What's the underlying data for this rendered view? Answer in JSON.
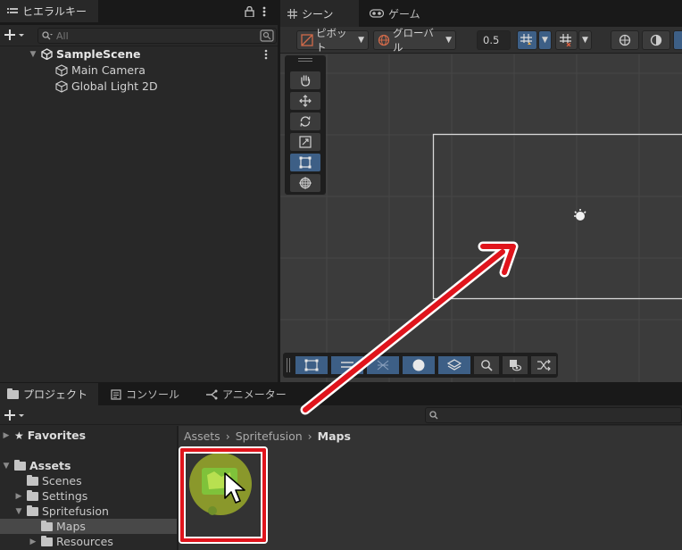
{
  "hierarchy": {
    "tab_label": "ヒエラルキー",
    "search_placeholder": "All",
    "scene_name": "SampleScene",
    "objects": [
      "Main Camera",
      "Global Light 2D"
    ]
  },
  "scene": {
    "tabs": [
      {
        "label": "シーン",
        "icon": "grid-icon"
      },
      {
        "label": "ゲーム",
        "icon": "gamepad-icon"
      }
    ],
    "toolbar": {
      "pivot_label": "ピボット",
      "global_label": "グローバル",
      "snap_value": "0.5"
    },
    "tools": [
      "hand-tool",
      "move-tool",
      "rotate-tool",
      "scale-tool",
      "rect-tool",
      "transform-tool"
    ],
    "selected_tool": "rect-tool"
  },
  "project": {
    "tabs": [
      {
        "label": "プロジェクト",
        "icon": "folder-icon"
      },
      {
        "label": "コンソール",
        "icon": "console-icon"
      },
      {
        "label": "アニメーター",
        "icon": "animator-icon"
      }
    ],
    "breadcrumb": [
      "Assets",
      "Spritefusion",
      "Maps"
    ],
    "favorites_label": "Favorites",
    "tree": [
      {
        "label": "Assets",
        "depth": 0,
        "expanded": true
      },
      {
        "label": "Scenes",
        "depth": 1
      },
      {
        "label": "Settings",
        "depth": 1
      },
      {
        "label": "Spritefusion",
        "depth": 1,
        "expanded": true
      },
      {
        "label": "Maps",
        "depth": 2,
        "selected": true
      },
      {
        "label": "Resources",
        "depth": 2
      }
    ]
  },
  "annotations": {
    "highlight_color": "#e0141c",
    "arrow_color": "#e0141c"
  },
  "colors": {
    "accent": "#3d5f86",
    "panel": "#282828",
    "viewport": "#3b3b3b"
  }
}
